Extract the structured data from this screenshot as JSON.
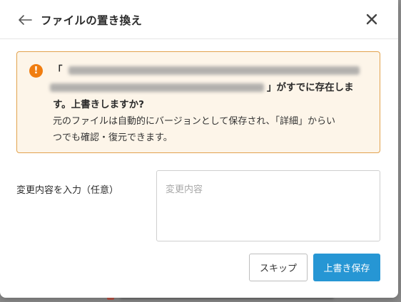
{
  "dialog": {
    "title": "ファイルの置き換え",
    "back_icon": "arrow-left-icon",
    "close_icon": "close-icon"
  },
  "warning": {
    "icon": "exclamation-icon",
    "open_quote": "「",
    "message_tail_1": "」がすでに存在しま",
    "message_tail_2": "す。上書きしますか?",
    "detail_line_1": "元のファイルは自動的にバージョンとして保存され、「詳細」からい",
    "detail_line_2": "つでも確認・復元できます。",
    "colors": {
      "background": "#fdf5e9",
      "border": "#e2a24d",
      "icon": "#f07d10"
    }
  },
  "form": {
    "change_label": "変更内容を入力（任意）",
    "change_placeholder": "変更内容",
    "change_value": ""
  },
  "actions": {
    "skip_label": "スキップ",
    "save_label": "上書き保存",
    "save_color": "#2696d4"
  }
}
